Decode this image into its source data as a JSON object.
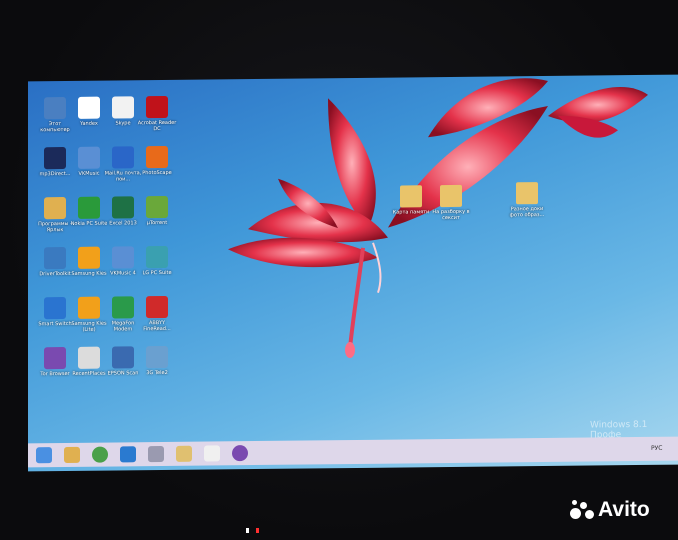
{
  "desktop": {
    "icons": [
      {
        "label": "Этот компьютер",
        "color": "#4a7fc1"
      },
      {
        "label": "Yandex",
        "color": "#ffffff"
      },
      {
        "label": "Skype",
        "color": "#f2f2f2"
      },
      {
        "label": "Acrobat Reader DC",
        "color": "#c0121a"
      },
      {
        "label": "mp3Direct...",
        "color": "#1b2a5a"
      },
      {
        "label": "VKMusic",
        "color": "#5a8fd4"
      },
      {
        "label": "Mail.Ru почта, пои...",
        "color": "#2a66c8"
      },
      {
        "label": "PhotoScape",
        "color": "#e86a1a"
      },
      {
        "label": "Программы - Ярлык",
        "color": "#e0b050"
      },
      {
        "label": "Nokia PC Suite",
        "color": "#2a9a3a"
      },
      {
        "label": "Excel 2013",
        "color": "#1e7145"
      },
      {
        "label": "µTorrent",
        "color": "#6aa83a"
      },
      {
        "label": "DriverToolkit",
        "color": "#3a7ac0"
      },
      {
        "label": "Samsung Kies",
        "color": "#f2a01a"
      },
      {
        "label": "VKMusic 4",
        "color": "#5a8fd4"
      },
      {
        "label": "LG PC Suite",
        "color": "#3aa0b0"
      },
      {
        "label": "Smart Switch",
        "color": "#2a74d0"
      },
      {
        "label": "Samsung Kies (Lite)",
        "color": "#f2a01a"
      },
      {
        "label": "MegaFon Modem",
        "color": "#2a9a4a"
      },
      {
        "label": "ABBYY FineRead...",
        "color": "#d02a2a"
      },
      {
        "label": "Tor Browser",
        "color": "#7a4ab0"
      },
      {
        "label": "RecentPlaces",
        "color": "#dcdcdc"
      },
      {
        "label": "EPSON Scan",
        "color": "#3a6ab0"
      },
      {
        "label": "3G Tele2",
        "color": "#6aa0d0"
      }
    ],
    "folders": [
      {
        "label": "Карта памяти"
      },
      {
        "label": "На разборку в сексит"
      },
      {
        "label": "Разное доки фото образ..."
      }
    ]
  },
  "watermark": "Windows 8.1 Профе",
  "taskbar": {
    "language": "РУС",
    "apps": [
      {
        "name": "windows-logo-icon",
        "color": "#4a90e2"
      },
      {
        "name": "folder-app-icon",
        "color": "#e0b050"
      },
      {
        "name": "chrome-icon",
        "color": "#4aa04a"
      },
      {
        "name": "ie-icon",
        "color": "#2a7ad0"
      },
      {
        "name": "app-tile-icon",
        "color": "#9a9ab0"
      },
      {
        "name": "explorer-icon",
        "color": "#e0c070"
      },
      {
        "name": "document-icon",
        "color": "#f0f0f0"
      },
      {
        "name": "tor-icon",
        "color": "#7a4ab0"
      }
    ]
  },
  "overlay": {
    "brand": "Avito"
  }
}
